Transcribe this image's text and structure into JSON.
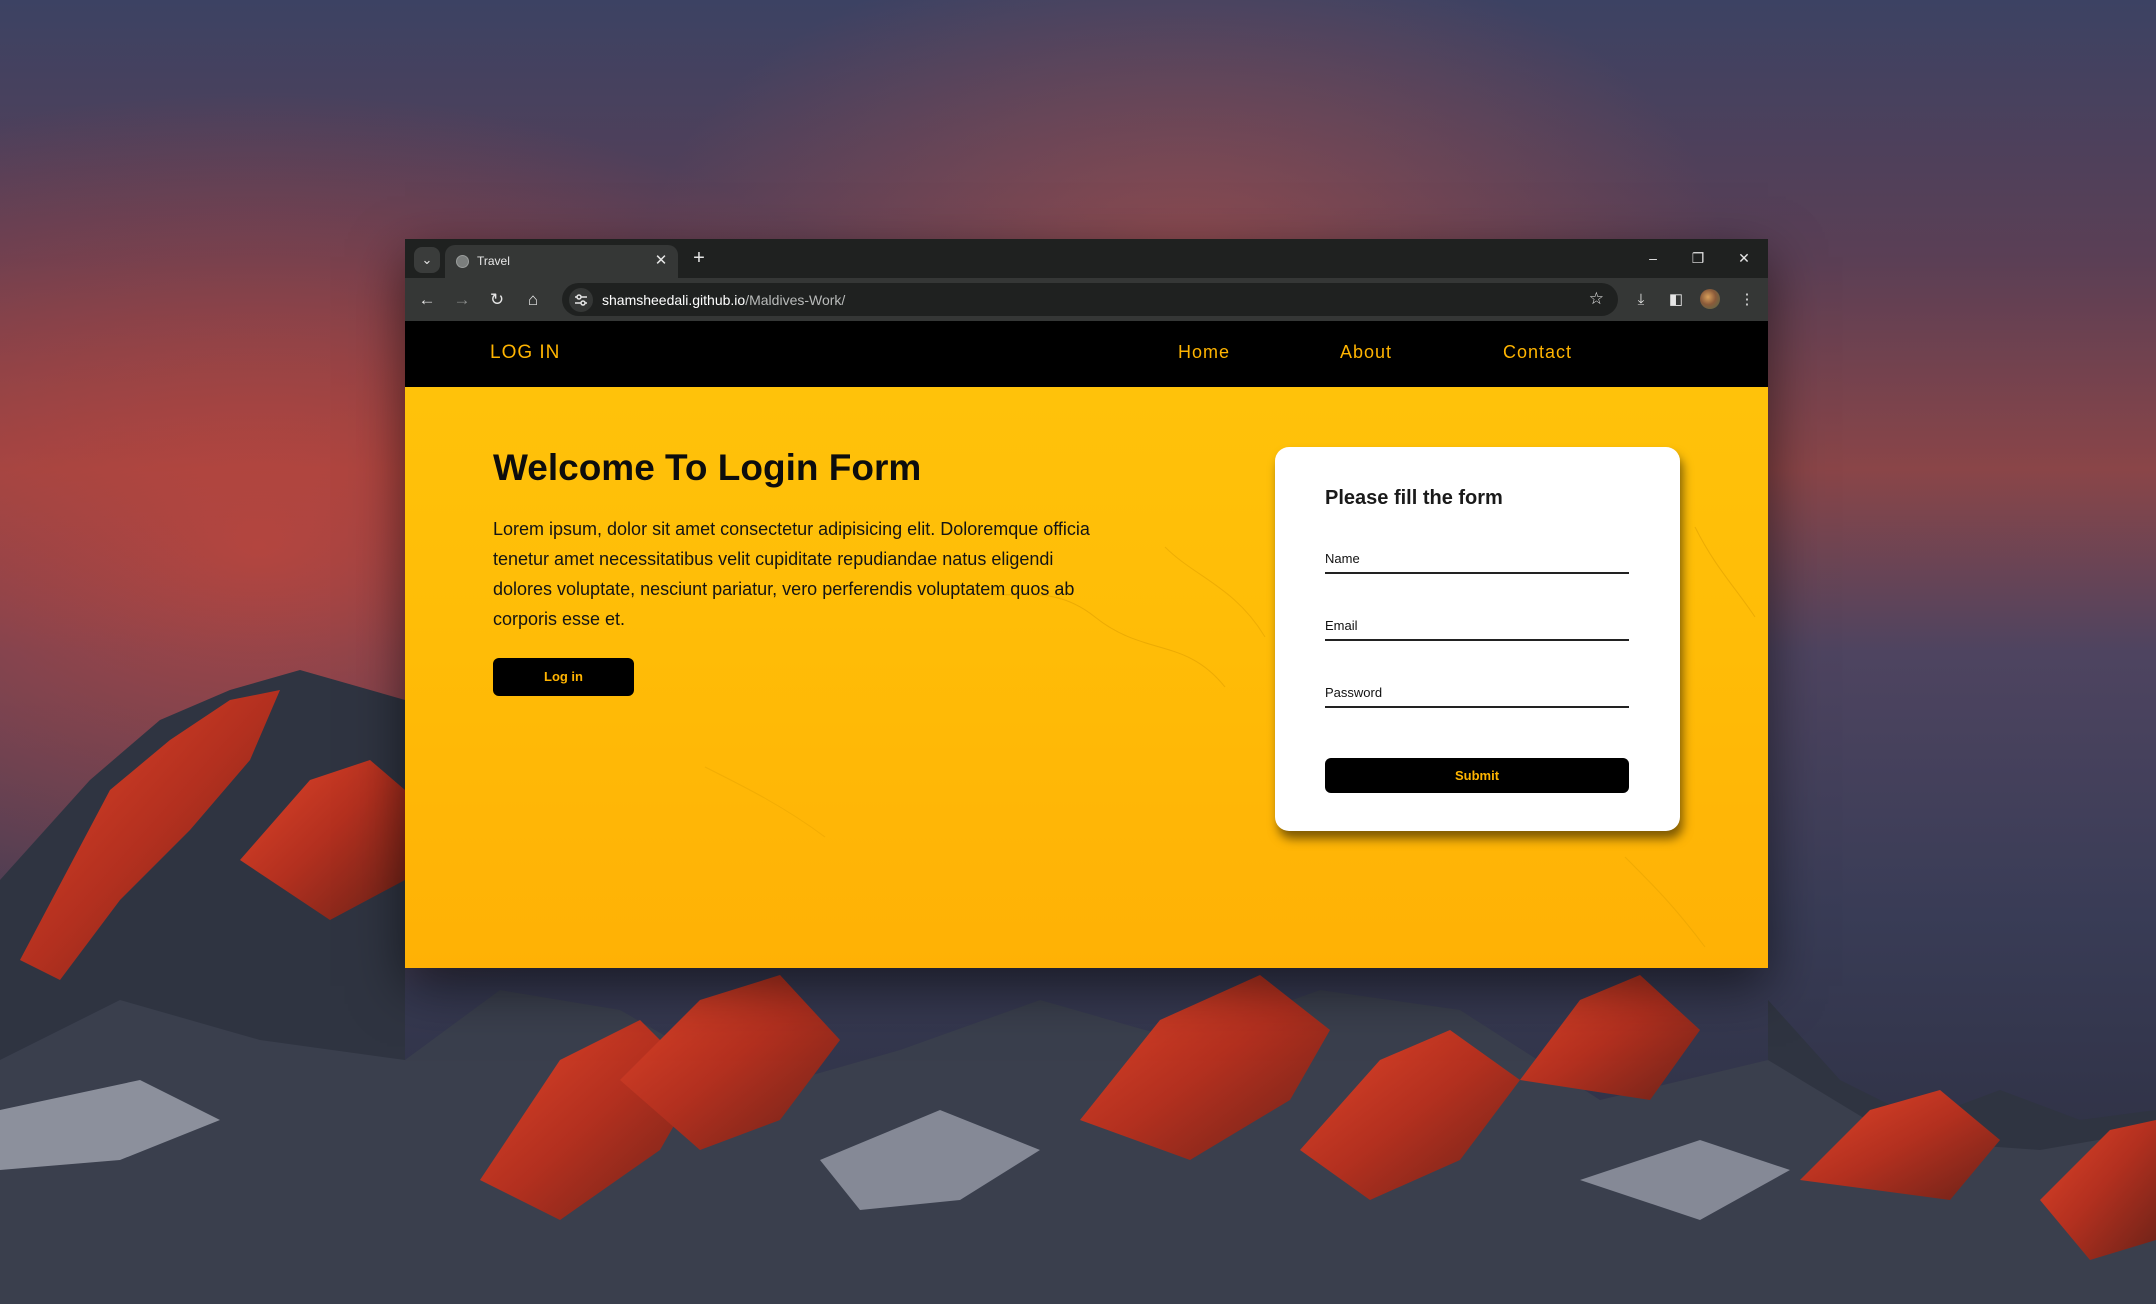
{
  "browser": {
    "tab_title": "Travel",
    "url_host": "shamsheedali.github.io",
    "url_path": "/Maldives-Work/"
  },
  "site": {
    "brand": "LOG IN",
    "nav": [
      "Home",
      "About",
      "Contact"
    ]
  },
  "hero": {
    "title": "Welcome To Login Form",
    "text": "Lorem ipsum, dolor sit amet consectetur adipisicing elit. Doloremque officia tenetur amet necessitatibus velit cupiditate repudiandae natus eligendi dolores voluptate, nesciunt pariatur, vero perferendis voluptatem quos ab corporis esse et.",
    "button_label": "Log in"
  },
  "form": {
    "title": "Please fill the form",
    "fields": [
      "Name",
      "Email",
      "Password"
    ],
    "submit_label": "Submit"
  },
  "colors": {
    "accent": "#ffb400",
    "hero_background": "#ffbd07",
    "nav_background": "#000000"
  }
}
